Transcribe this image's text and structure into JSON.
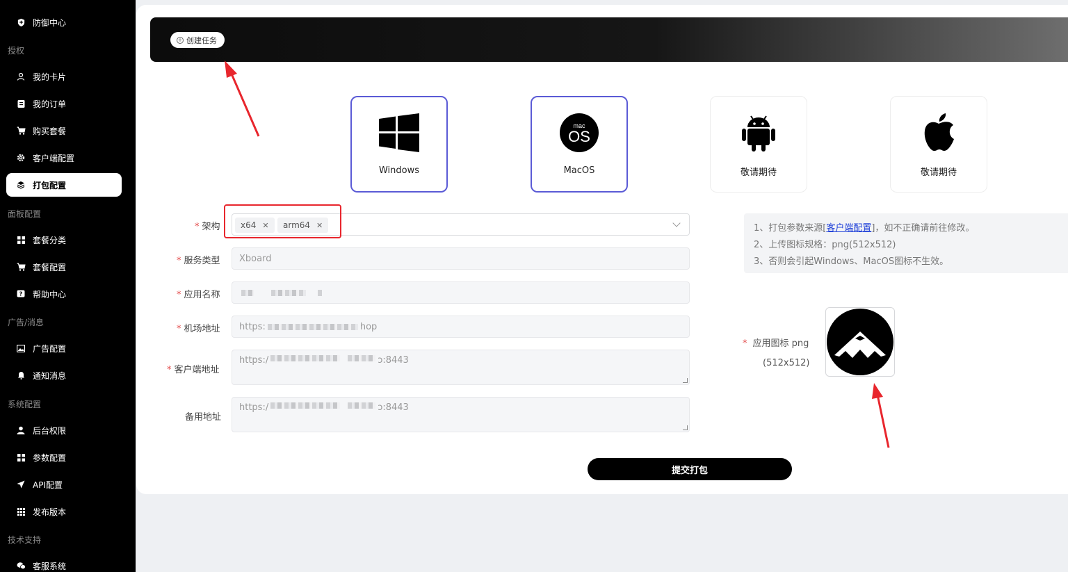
{
  "sidebar": {
    "top_item": {
      "label": "防御中心",
      "icon": "shield-icon"
    },
    "groups": [
      {
        "title": "授权",
        "items": [
          {
            "label": "我的卡片",
            "icon": "user-icon"
          },
          {
            "label": "我的订单",
            "icon": "clipboard-icon"
          },
          {
            "label": "购买套餐",
            "icon": "cart-icon"
          },
          {
            "label": "客户端配置",
            "icon": "gear-icon"
          },
          {
            "label": "打包配置",
            "icon": "layers-icon",
            "active": true
          }
        ]
      },
      {
        "title": "面板配置",
        "items": [
          {
            "label": "套餐分类",
            "icon": "grid-icon"
          },
          {
            "label": "套餐配置",
            "icon": "cart-icon"
          },
          {
            "label": "帮助中心",
            "icon": "help-icon"
          }
        ]
      },
      {
        "title": "广告/消息",
        "items": [
          {
            "label": "广告配置",
            "icon": "image-icon"
          },
          {
            "label": "通知消息",
            "icon": "bell-icon"
          }
        ]
      },
      {
        "title": "系统配置",
        "items": [
          {
            "label": "后台权限",
            "icon": "person-icon"
          },
          {
            "label": "参数配置",
            "icon": "grid-icon"
          },
          {
            "label": "API配置",
            "icon": "send-icon"
          },
          {
            "label": "发布版本",
            "icon": "dots-grid-icon"
          }
        ]
      },
      {
        "title": "技术支持",
        "items": [
          {
            "label": "客服系统",
            "icon": "chat-icon"
          }
        ]
      }
    ]
  },
  "header": {
    "create_task_label": "创建任务"
  },
  "platforms": [
    {
      "label": "Windows",
      "icon": "windows-icon",
      "selected": true
    },
    {
      "label": "MacOS",
      "icon": "macos-icon",
      "selected": true
    },
    {
      "label": "敬请期待",
      "icon": "android-icon",
      "selected": false
    },
    {
      "label": "敬请期待",
      "icon": "apple-icon",
      "selected": false
    }
  ],
  "form": {
    "arch": {
      "label": "架构",
      "tags": [
        "x64",
        "arm64"
      ]
    },
    "service_type": {
      "label": "服务类型",
      "value": "Xboard"
    },
    "app_name": {
      "label": "应用名称"
    },
    "airport_url": {
      "label": "机场地址",
      "prefix": "https:",
      "suffix": "hop"
    },
    "client_url": {
      "label": "客户端地址",
      "prefix": "https:/",
      "suffix": "ɔ:8443"
    },
    "backup_url": {
      "label": "备用地址",
      "prefix": "https:/",
      "suffix": "ɔ:8443"
    },
    "app_icon": {
      "label": "应用图标 png",
      "sub": "(512x512)"
    },
    "submit_label": "提交打包"
  },
  "notes": {
    "line1_prefix": "1、打包参数来源[",
    "line1_link": "客户端配置",
    "line1_suffix": "]，如不正确请前往修改。",
    "line2": "2、上传图标规格：png(512x512)",
    "line3": "3、否则会引起Windows、MacOS图标不生效。"
  },
  "colors": {
    "accent": "#5b5bd6",
    "annotation_red": "#e8262d",
    "required": "#e34d4d"
  }
}
